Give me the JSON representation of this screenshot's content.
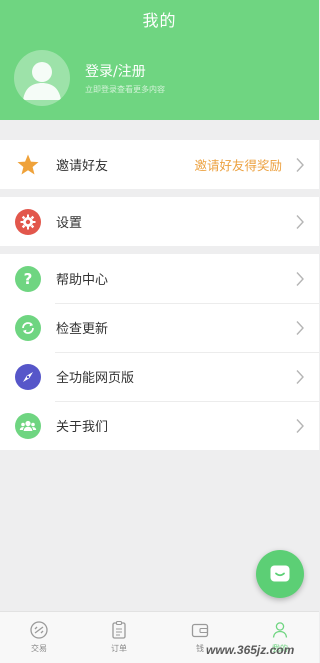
{
  "header": {
    "title": "我的",
    "login_title": "登录/注册",
    "login_subtitle": "立即登录查看更多内容"
  },
  "invite": {
    "label": "邀请好友",
    "hint": "邀请好友得奖励"
  },
  "settings": {
    "label": "设置"
  },
  "menu": [
    {
      "label": "帮助中心"
    },
    {
      "label": "检查更新"
    },
    {
      "label": "全功能网页版"
    },
    {
      "label": "关于我们"
    }
  ],
  "tabs": [
    {
      "label": "交易"
    },
    {
      "label": "订单"
    },
    {
      "label": "钱"
    },
    {
      "label": "我的"
    }
  ],
  "watermark": "www.365jz.com",
  "colors": {
    "brand_green": "#6fd581",
    "star": "#efa23a",
    "settings_red": "#e2574c",
    "help_green": "#6fd581",
    "compass_purple": "#5656c9",
    "hint_orange": "#eca140"
  }
}
